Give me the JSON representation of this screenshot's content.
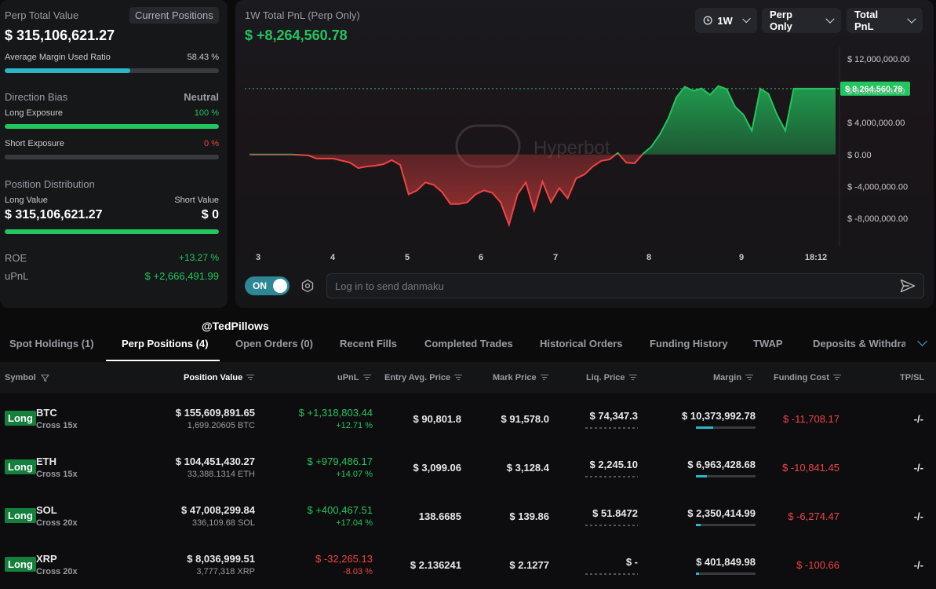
{
  "left": {
    "perp_total_label": "Perp Total Value",
    "current_positions_btn": "Current Positions",
    "perp_total_value": "$ 315,106,621.27",
    "avg_margin_label": "Average Margin Used Ratio",
    "avg_margin_value": "58.43 %",
    "avg_margin_fraction": 0.5843,
    "direction_bias_label": "Direction Bias",
    "direction_bias_value": "Neutral",
    "long_exposure_label": "Long Exposure",
    "long_exposure_value": "100 %",
    "short_exposure_label": "Short Exposure",
    "short_exposure_value": "0 %",
    "position_dist_label": "Position Distribution",
    "long_value_label": "Long Value",
    "short_value_label": "Short Value",
    "long_value": "$ 315,106,621.27",
    "short_value": "$ 0",
    "roe_label": "ROE",
    "roe_value": "+13.27 %",
    "upnl_label": "uPnL",
    "upnl_value": "$ +2,666,491.99"
  },
  "chart_header": {
    "title": "1W Total PnL (Perp Only)",
    "value": "$ +8,264,560.78",
    "btn_period": "1W",
    "btn_scope": "Perp Only",
    "btn_metric": "Total PnL",
    "watermark": "Hyperbot",
    "danmaku_toggle": "ON",
    "danmaku_placeholder": "Log in to send danmaku"
  },
  "chart_data": {
    "type": "area",
    "title": "1W Total PnL (Perp Only)",
    "x_ticks": [
      "3",
      "4",
      "5",
      "6",
      "7",
      "8",
      "9",
      "18:12"
    ],
    "y_ticks": [
      "$ 12,000,000.00",
      "$ 8,000,000.00",
      "$ 4,000,000.00",
      "$ 0.00",
      "$ -4,000,000.00",
      "$ -8,000,000.00"
    ],
    "ylim": [
      -9000000,
      13000000
    ],
    "current_label": "$ 8,264,560.78",
    "current_value": 8264560.78,
    "series": [
      {
        "name": "Total PnL",
        "x": [
          3.0,
          3.3,
          3.5,
          3.7,
          3.8,
          4.0,
          4.2,
          4.3,
          4.4,
          4.5,
          4.6,
          4.7,
          4.8,
          4.9,
          5.0,
          5.1,
          5.2,
          5.3,
          5.4,
          5.5,
          5.6,
          5.7,
          5.8,
          5.9,
          6.0,
          6.1,
          6.2,
          6.3,
          6.4,
          6.5,
          6.6,
          6.7,
          6.8,
          6.9,
          7.0,
          7.1,
          7.2,
          7.3,
          7.4,
          7.5,
          7.6,
          7.7,
          7.8,
          7.9,
          8.0,
          8.1,
          8.2,
          8.3,
          8.4,
          8.5,
          8.6,
          8.7,
          8.8,
          8.9,
          9.0,
          9.1,
          9.2,
          9.3,
          9.4,
          9.5,
          9.6,
          9.7,
          9.8,
          9.9,
          10.0
        ],
        "y": [
          0,
          0,
          0,
          -100000,
          -500000,
          -500000,
          -1000000,
          -1700000,
          -1500000,
          -1400000,
          -1200000,
          -700000,
          -1300000,
          -5000000,
          -4500000,
          -3500000,
          -3800000,
          -4700000,
          -6200000,
          -6200000,
          -6000000,
          -5000000,
          -4500000,
          -4800000,
          -6000000,
          -8800000,
          -5000000,
          -3500000,
          -7000000,
          -3400000,
          -6000000,
          -4200000,
          -5500000,
          -3000000,
          -2500000,
          -1500000,
          -800000,
          -600000,
          200000,
          -1000000,
          -1100000,
          100000,
          1000000,
          2500000,
          4500000,
          7200000,
          8500000,
          8000000,
          8300000,
          7500000,
          8600000,
          8200000,
          6000000,
          5000000,
          3000000,
          8264560.78,
          7600000,
          5000000,
          3000000,
          8264560.78,
          8264560.78,
          8264560.78,
          8264560.78,
          8264560.78,
          8264560.78
        ]
      }
    ]
  },
  "watermark_text": "@TedPillows",
  "tabs": [
    "Spot Holdings (1)",
    "Perp Positions (4)",
    "Open Orders (0)",
    "Recent Fills",
    "Completed Trades",
    "Historical Orders",
    "Funding History",
    "TWAP",
    "Deposits & Withdraw"
  ],
  "table": {
    "headers": [
      "Symbol",
      "Position Value",
      "uPnL",
      "Entry Avg. Price",
      "Mark Price",
      "Liq. Price",
      "Margin",
      "Funding Cost",
      "TP/SL"
    ],
    "rows": [
      {
        "side": "Long",
        "symbol": "BTC",
        "leverage": "Cross 15x",
        "position_value": "$ 155,609,891.65",
        "position_size": "1,699.20605 BTC",
        "upnl": "$ +1,318,803.44",
        "upnl_pct": "+12.71 %",
        "upnl_positive": true,
        "entry": "$ 90,801.8",
        "mark": "$ 91,578.0",
        "liq": "$ 74,347.3",
        "margin": "$ 10,373,992.78",
        "margin_fraction": 0.29,
        "funding": "$ -11,708.17",
        "tpsl": "-/-"
      },
      {
        "side": "Long",
        "symbol": "ETH",
        "leverage": "Cross 15x",
        "position_value": "$ 104,451,430.27",
        "position_size": "33,388.1314 ETH",
        "upnl": "$ +979,486.17",
        "upnl_pct": "+14.07 %",
        "upnl_positive": true,
        "entry": "$ 3,099.06",
        "mark": "$ 3,128.4",
        "liq": "$ 2,245.10",
        "margin": "$ 6,963,428.68",
        "margin_fraction": 0.19,
        "funding": "$ -10,841.45",
        "tpsl": "-/-"
      },
      {
        "side": "Long",
        "symbol": "SOL",
        "leverage": "Cross 20x",
        "position_value": "$ 47,008,299.84",
        "position_size": "336,109.68 SOL",
        "upnl": "$ +400,467.51",
        "upnl_pct": "+17.04 %",
        "upnl_positive": true,
        "entry": "138.6685",
        "mark": "$ 139.86",
        "liq": "$ 51.8472",
        "margin": "$ 2,350,414.99",
        "margin_fraction": 0.08,
        "funding": "$ -6,274.47",
        "tpsl": "-/-"
      },
      {
        "side": "Long",
        "symbol": "XRP",
        "leverage": "Cross 20x",
        "position_value": "$ 8,036,999.51",
        "position_size": "3,777,318 XRP",
        "upnl": "$ -32,265.13",
        "upnl_pct": "-8.03 %",
        "upnl_positive": false,
        "entry": "$ 2.136241",
        "mark": "$ 2.1277",
        "liq": "$ -",
        "margin": "$ 401,849.98",
        "margin_fraction": 0.05,
        "funding": "$ -100.66",
        "tpsl": "-/-"
      }
    ]
  },
  "colors": {
    "positive": "#22c55e",
    "negative": "#ef4444",
    "accent": "#2bb5c9",
    "long_badge": "#15803d"
  }
}
